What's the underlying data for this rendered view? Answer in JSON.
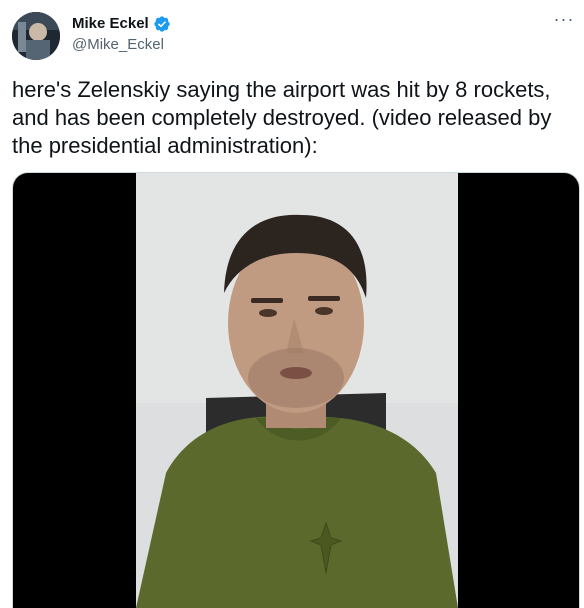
{
  "author": {
    "display_name": "Mike Eckel",
    "handle": "@Mike_Eckel",
    "verified": true
  },
  "tweet": {
    "text": "here's Zelenskiy saying the airport was hit by 8 rockets, and has been completely destroyed. (video released by the presidential administration):"
  },
  "icons": {
    "more": "more-options-icon",
    "verified": "verified-badge-icon"
  },
  "colors": {
    "verified_blue": "#1d9bf0",
    "secondary_text": "#536471"
  }
}
